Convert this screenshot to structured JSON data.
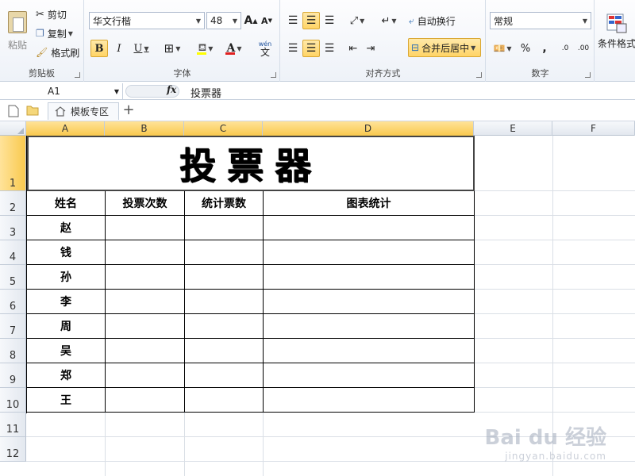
{
  "colors": {
    "accent_active": "#ffd466",
    "header_selected": "#f9c94e",
    "font_color_red": "#e02020",
    "fill_yellow": "#ffff00"
  },
  "ribbon": {
    "clipboard": {
      "paste_label": "粘贴",
      "cut_label": "剪切",
      "copy_label": "复制",
      "format_painter_label": "格式刷",
      "title": "剪贴板"
    },
    "font": {
      "family": "华文行楷",
      "size": "48",
      "bold": "B",
      "italic": "I",
      "underline": "U",
      "grow": "A",
      "shrink": "A",
      "wen": "wén",
      "wen_char": "文",
      "title": "字体"
    },
    "alignment": {
      "wrap_label": "自动换行",
      "merge_label": "合并后居中",
      "title": "对齐方式"
    },
    "number": {
      "format": "常规",
      "percent": "%",
      "comma": ",",
      "inc_dec": ".0",
      "dec_dec": ".00",
      "title": "数字"
    },
    "styles": {
      "conditional_label": "条件格式"
    }
  },
  "formula_bar": {
    "name_box": "A1",
    "fx": "fx",
    "content": "投票器"
  },
  "tabs": {
    "template_label": "模板专区",
    "add": "+"
  },
  "sheet": {
    "columns": [
      "A",
      "B",
      "C",
      "D",
      "E",
      "F"
    ],
    "rows": [
      "1",
      "2",
      "3",
      "4",
      "5",
      "6",
      "7",
      "8",
      "9",
      "10",
      "11",
      "12"
    ],
    "title": "投票器",
    "headers": [
      "姓名",
      "投票次数",
      "统计票数",
      "图表统计"
    ],
    "names": [
      "赵",
      "钱",
      "孙",
      "李",
      "周",
      "吴",
      "郑",
      "王"
    ]
  },
  "watermark": {
    "brand": "Bai du 经验",
    "url": "jingyan.baidu.com"
  }
}
